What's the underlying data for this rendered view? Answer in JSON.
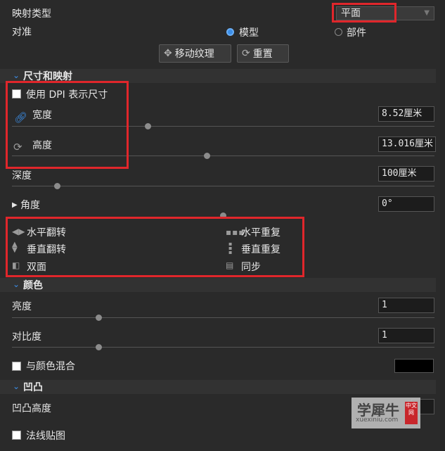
{
  "mapping": {
    "type_label": "映射类型",
    "type_value": "平面",
    "align_label": "对准",
    "radio_model": "模型",
    "radio_part": "部件",
    "move_texture_btn": "移动纹理",
    "reset_btn": "重置"
  },
  "size_section": {
    "title": "尺寸和映射",
    "use_dpi_label": "使用 DPI 表示尺寸",
    "width_label": "宽度",
    "width_value": "8.52厘米",
    "height_label": "高度",
    "height_value": "13.016厘米",
    "depth_label": "深度",
    "depth_value": "100厘米",
    "angle_label": "角度",
    "angle_value": "0°",
    "flip_h": "水平翻转",
    "flip_v": "垂直翻转",
    "double_side": "双面",
    "repeat_h": "水平重复",
    "repeat_v": "垂直重复",
    "sync": "同步"
  },
  "color_section": {
    "title": "颜色",
    "brightness_label": "亮度",
    "brightness_value": "1",
    "contrast_label": "对比度",
    "contrast_value": "1",
    "blend_label": "与颜色混合",
    "blend_color": "#000000"
  },
  "bump_section": {
    "title": "凹凸",
    "bump_height_label": "凹凸高度",
    "normal_map_label": "法线贴图"
  },
  "watermark": {
    "brand": "学犀牛",
    "side": "中文网",
    "url": "xuexiniu.com"
  },
  "colors": {
    "accent": "#3b8ee8",
    "highlight": "#e0262b",
    "background": "#2a2a2a"
  }
}
